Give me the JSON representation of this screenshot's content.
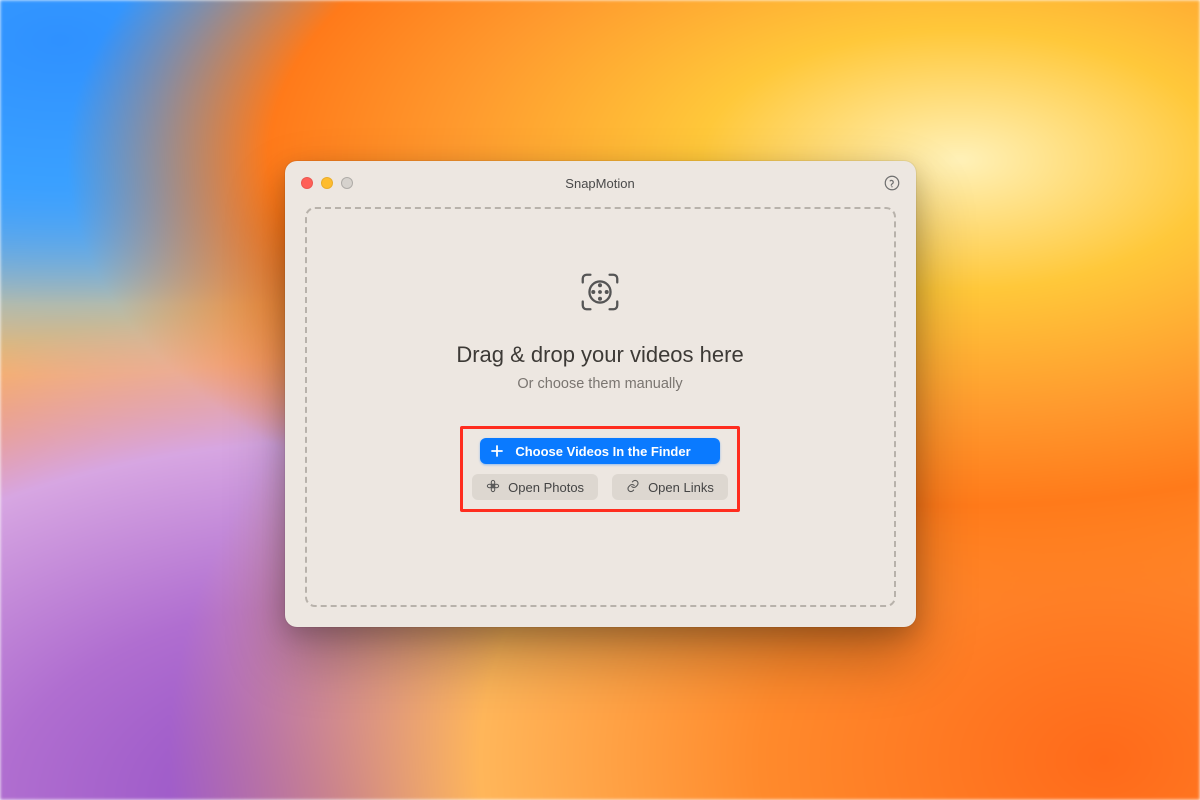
{
  "window": {
    "title": "SnapMotion"
  },
  "dropzone": {
    "title": "Drag & drop your videos here",
    "subtitle": "Or choose them manually"
  },
  "buttons": {
    "choose_finder": "Choose Videos In the Finder",
    "open_photos": "Open Photos",
    "open_links": "Open Links"
  }
}
